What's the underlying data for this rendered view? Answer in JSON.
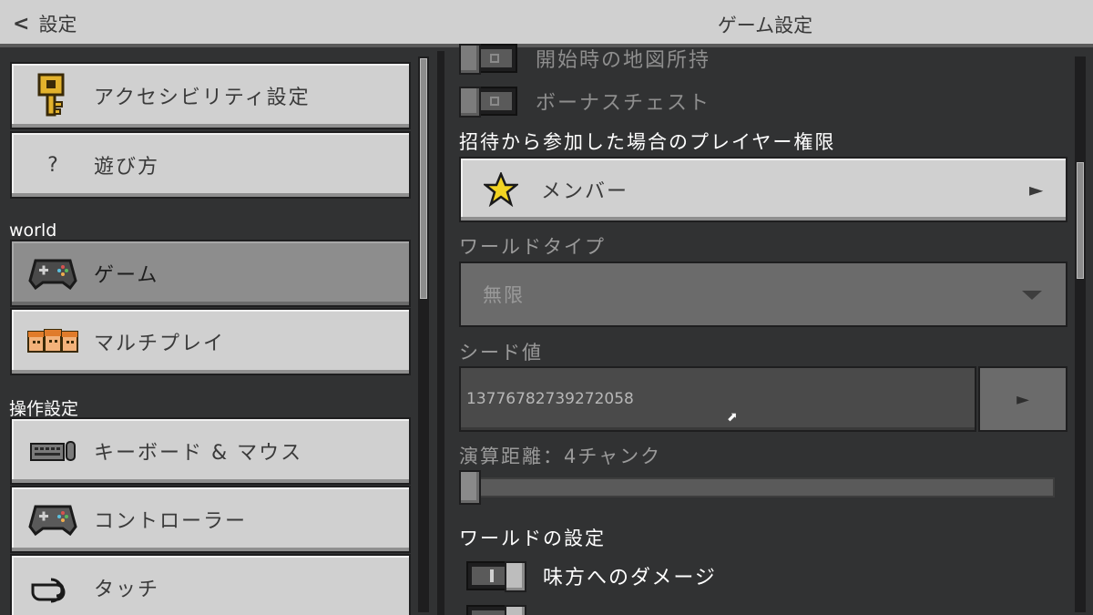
{
  "header": {
    "back_label": "設定",
    "title": "ゲーム設定"
  },
  "sidebar": {
    "items_top": [
      {
        "label": "アクセシビリティ設定",
        "icon": "key-icon"
      },
      {
        "label": "遊び方",
        "icon": "question-icon",
        "glyph": "?"
      }
    ],
    "section_world": "world",
    "items_world": [
      {
        "label": "ゲーム",
        "icon": "controller-icon",
        "selected": true
      },
      {
        "label": "マルチプレイ",
        "icon": "players-icon"
      }
    ],
    "section_controls": "操作設定",
    "items_controls": [
      {
        "label": "キーボード & マウス",
        "icon": "keyboard-mouse-icon"
      },
      {
        "label": "コントローラー",
        "icon": "controller-icon"
      },
      {
        "label": "タッチ",
        "icon": "touch-hand-icon"
      }
    ]
  },
  "settings": {
    "starting_map": {
      "label": "開始時の地図所持",
      "state": "off",
      "enabled": false
    },
    "bonus_chest": {
      "label": "ボーナスチェスト",
      "state": "off",
      "enabled": false
    },
    "invite_permission": {
      "label": "招待から参加した場合のプレイヤー権限",
      "value": "メンバー",
      "icon": "star-icon"
    },
    "world_type": {
      "label": "ワールドタイプ",
      "value": "無限",
      "enabled": false
    },
    "seed": {
      "label": "シード値",
      "value": "13776782739272058"
    },
    "simulation_distance": {
      "label": "演算距離：4チャンク",
      "level": 4
    },
    "world_settings_heading": "ワールドの設定",
    "friendly_fire": {
      "label": "味方へのダメージ",
      "state": "on"
    }
  },
  "colors": {
    "background": "#313233",
    "button_light": "#d0d0d0",
    "button_selected": "#8d8d8d",
    "text_light": "#ffffff",
    "text_dim": "#9a9a9a"
  }
}
